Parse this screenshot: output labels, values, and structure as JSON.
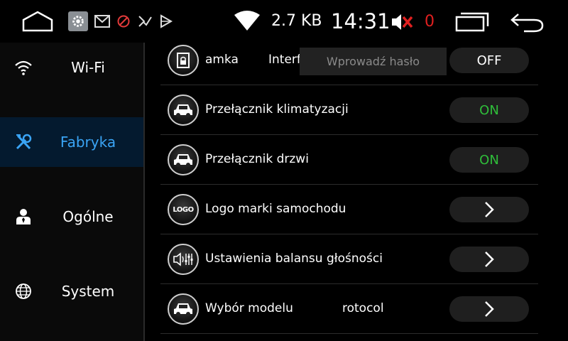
{
  "statusbar": {
    "net_speed": "2.7 KB",
    "clock": "14:31",
    "volume_count": "0",
    "icons": [
      "home-icon",
      "settings-icon",
      "mail-icon",
      "block-icon",
      "check-icon",
      "play-icon",
      "wifi-icon",
      "volume-muted-icon",
      "recents-icon",
      "back-icon"
    ],
    "colors": {
      "volume_count": "#e02020",
      "mute_x": "#e02020"
    }
  },
  "sidebar": {
    "items": [
      {
        "label": "Wi-Fi",
        "icon": "wifi-icon"
      },
      {
        "label": "Fabryka",
        "icon": "tools-icon",
        "active": true
      },
      {
        "label": "Ogólne",
        "icon": "person-icon"
      },
      {
        "label": "System",
        "icon": "globe-icon"
      }
    ],
    "active_color": "#3aa4f5"
  },
  "settings": {
    "rows": [
      {
        "label": "amka",
        "extra": "Interf",
        "control": "OFF",
        "icon": "car-door-lock-icon"
      },
      {
        "label": "Przełącznik klimatyzacji",
        "control": "ON",
        "icon": "car-icon"
      },
      {
        "label": "Przełącznik drzwi",
        "control": "ON",
        "icon": "car-icon"
      },
      {
        "label": "Logo marki samochodu",
        "control": ">",
        "icon": "logo-icon",
        "icon_text": "LOGO"
      },
      {
        "label": "Ustawienia balansu głośności",
        "control": ">",
        "icon": "speaker-eq-icon"
      },
      {
        "label": "Wybór modelu",
        "extra": "rotocol",
        "control": ">",
        "icon": "car-icon"
      }
    ],
    "on_color": "#2fbe3a"
  },
  "password": {
    "placeholder": "Wprowadź hasło"
  }
}
